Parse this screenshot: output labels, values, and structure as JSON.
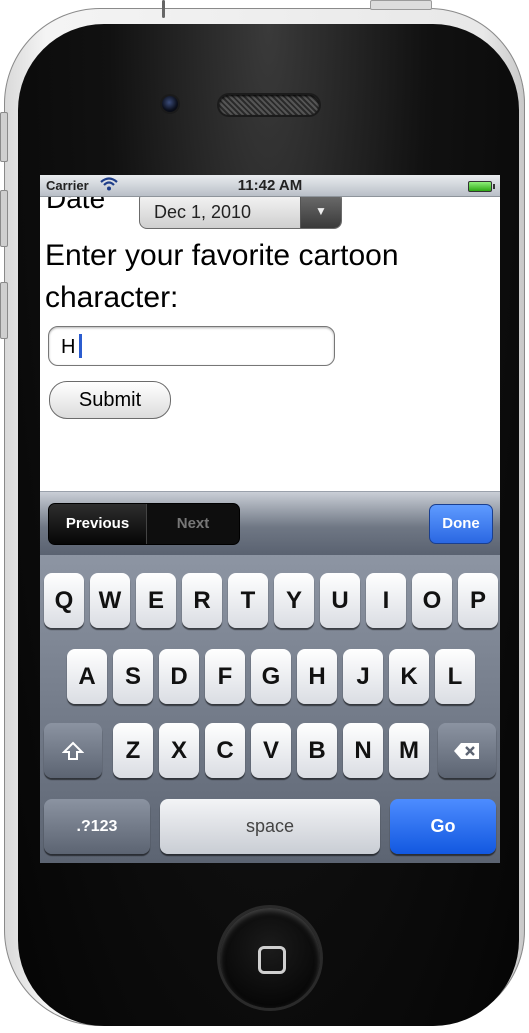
{
  "status_bar": {
    "carrier": "Carrier",
    "time": "11:42 AM"
  },
  "form": {
    "date_label": "Date",
    "date_value": "Dec 1, 2010",
    "prompt": "Enter your favorite cartoon character:",
    "input_value": "H",
    "submit_label": "Submit"
  },
  "form_accessory": {
    "previous": "Previous",
    "next": "Next",
    "done": "Done"
  },
  "keyboard": {
    "row1": [
      "Q",
      "W",
      "E",
      "R",
      "T",
      "Y",
      "U",
      "I",
      "O",
      "P"
    ],
    "row2": [
      "A",
      "S",
      "D",
      "F",
      "G",
      "H",
      "J",
      "K",
      "L"
    ],
    "row3": [
      "Z",
      "X",
      "C",
      "V",
      "B",
      "N",
      "M"
    ],
    "mode_key": ".?123",
    "space": "space",
    "go": "Go"
  },
  "icons": [
    "wifi-icon",
    "battery-icon",
    "shift-icon",
    "backspace-icon",
    "home-button-icon",
    "dropdown-arrow-icon"
  ]
}
